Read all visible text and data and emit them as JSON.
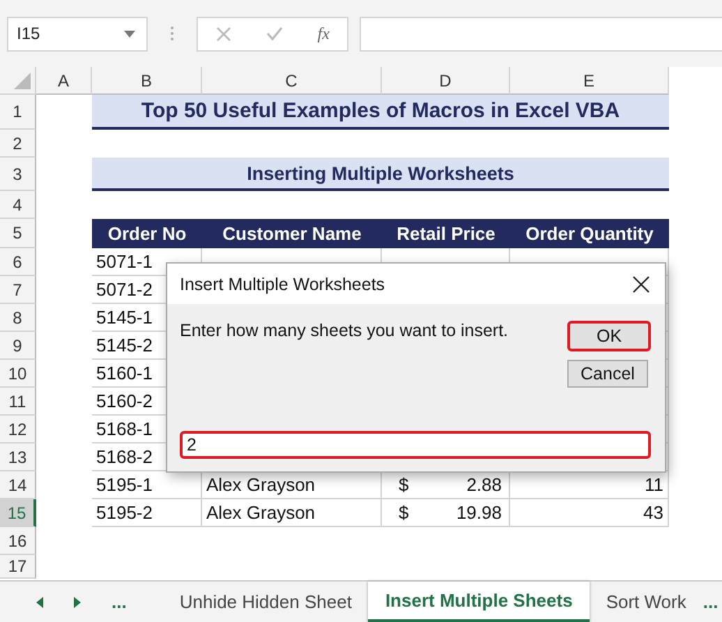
{
  "formula_bar": {
    "name_box": "I15",
    "fx": "fx"
  },
  "columns": [
    "A",
    "B",
    "C",
    "D",
    "E"
  ],
  "row_numbers": [
    {
      "label": "1",
      "selected": false
    },
    {
      "label": "2",
      "selected": false
    },
    {
      "label": "3",
      "selected": false
    },
    {
      "label": "4",
      "selected": false
    },
    {
      "label": "5",
      "selected": false
    },
    {
      "label": "6",
      "selected": false
    },
    {
      "label": "7",
      "selected": false
    },
    {
      "label": "8",
      "selected": false
    },
    {
      "label": "9",
      "selected": false
    },
    {
      "label": "10",
      "selected": false
    },
    {
      "label": "11",
      "selected": false
    },
    {
      "label": "12",
      "selected": false
    },
    {
      "label": "13",
      "selected": false
    },
    {
      "label": "14",
      "selected": false
    },
    {
      "label": "15",
      "selected": true
    },
    {
      "label": "16",
      "selected": false
    },
    {
      "label": "17",
      "selected": false
    }
  ],
  "title": "Top 50 Useful Examples of Macros in Excel VBA",
  "subtitle": "Inserting Multiple Worksheets",
  "table": {
    "columns": [
      "Order No",
      "Customer Name",
      "Retail Price",
      "Order Quantity"
    ],
    "rows": [
      {
        "order": "5071-1"
      },
      {
        "order": "5071-2"
      },
      {
        "order": "5145-1"
      },
      {
        "order": "5145-2"
      },
      {
        "order": "5160-1"
      },
      {
        "order": "5160-2"
      },
      {
        "order": "5168-1"
      },
      {
        "order": "5168-2"
      },
      {
        "order": "5195-1",
        "customer": "Alex Grayson",
        "currency": "$",
        "price": "2.88",
        "quantity": "11"
      },
      {
        "order": "5195-2",
        "customer": "Alex Grayson",
        "currency": "$",
        "price": "19.98",
        "quantity": "43"
      }
    ]
  },
  "sheet_tabs": {
    "more_left": "...",
    "tabs": [
      {
        "label": "Unhide Hidden Sheet",
        "selected": false
      },
      {
        "label": "Insert Multiple Sheets",
        "selected": true
      },
      {
        "label": "Sort Work",
        "selected": false
      }
    ],
    "more_right": "..."
  },
  "dialog": {
    "title": "Insert Multiple Worksheets",
    "message": "Enter how many sheets you want to insert.",
    "buttons": [
      {
        "label": "OK",
        "highlighted": true
      },
      {
        "label": "Cancel",
        "highlighted": false
      }
    ],
    "input": {
      "value": "2",
      "highlighted": true
    }
  }
}
